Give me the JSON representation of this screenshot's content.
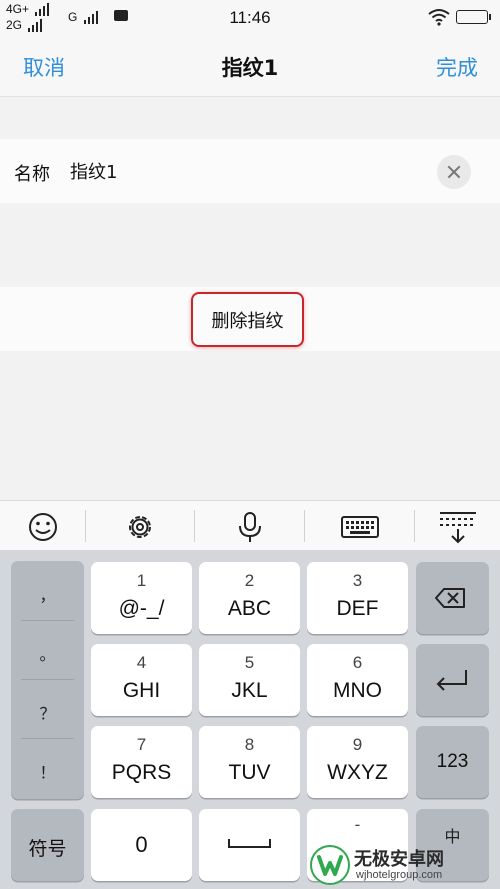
{
  "status_bar": {
    "network_1": "4G+",
    "network_2": "2G",
    "network_3": "G",
    "time": "11:46"
  },
  "nav": {
    "cancel_label": "取消",
    "title": "指纹1",
    "done_label": "完成"
  },
  "form": {
    "name_label": "名称",
    "name_value": "指纹1"
  },
  "actions": {
    "delete_label": "删除指纹"
  },
  "toolbar": {
    "items": [
      "emoji-icon",
      "gear-icon",
      "microphone-icon",
      "keyboard-icon",
      "hide-keyboard-icon"
    ]
  },
  "keyboard": {
    "punctuation": [
      "，",
      "。",
      "？",
      "！"
    ],
    "keys": [
      {
        "num": "1",
        "letters": "@-_/"
      },
      {
        "num": "2",
        "letters": "ABC"
      },
      {
        "num": "3",
        "letters": "DEF"
      },
      {
        "num": "4",
        "letters": "GHI"
      },
      {
        "num": "5",
        "letters": "JKL"
      },
      {
        "num": "6",
        "letters": "MNO"
      },
      {
        "num": "7",
        "letters": "PQRS"
      },
      {
        "num": "8",
        "letters": "TUV"
      },
      {
        "num": "9",
        "letters": "WXYZ"
      }
    ],
    "symbols_label": "符号",
    "zero_label": "0",
    "numbers_label": "123",
    "lang_label": "中",
    "space_top": "-",
    "lang_top": "-"
  },
  "watermark": {
    "title": "无极安卓网",
    "subtitle": "wjhotelgroup.com"
  },
  "colors": {
    "accent": "#2f8fd9",
    "highlight": "#c8262a"
  }
}
